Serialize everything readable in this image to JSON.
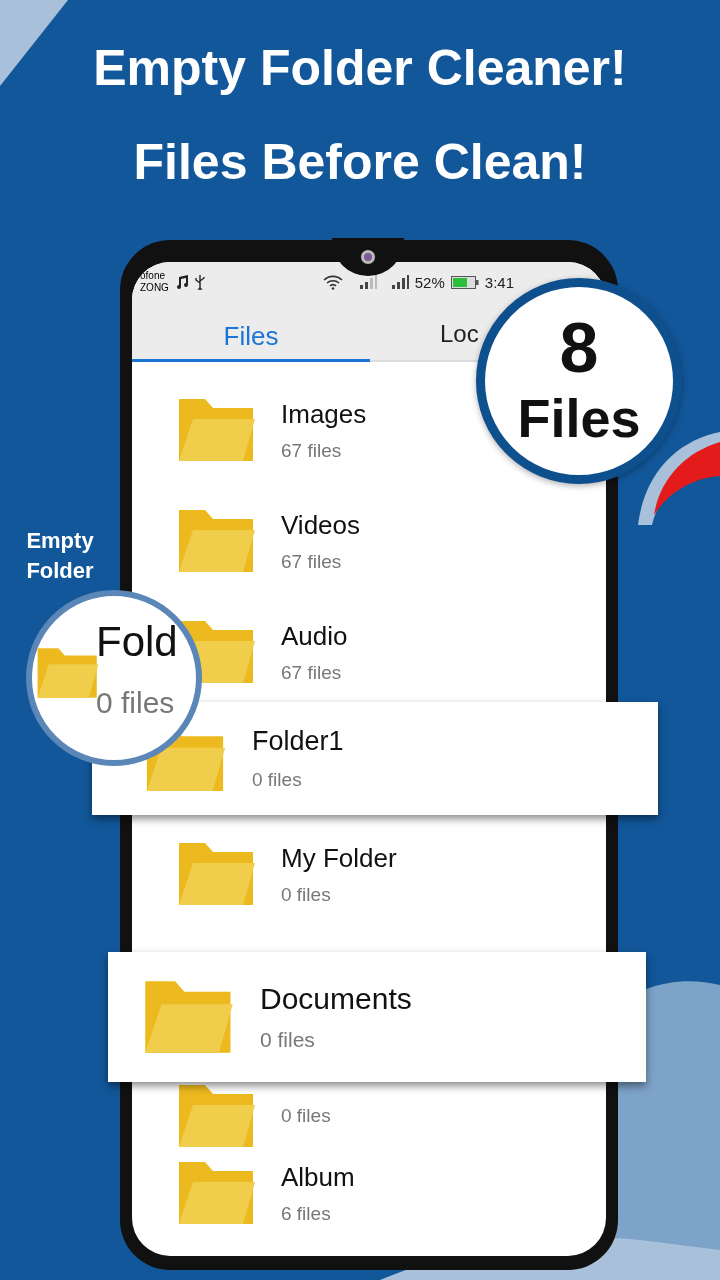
{
  "headline": [
    "Empty Folder Cleaner!",
    "Files Before Clean!"
  ],
  "side_label": "Empty Folder",
  "phone": {
    "status_bar": {
      "carrier": [
        "ofone",
        "ZONG"
      ],
      "battery": "52%",
      "time": "3:41"
    },
    "tabs": [
      {
        "label": "Files",
        "selected": true
      },
      {
        "label": "Loc",
        "selected": false
      }
    ],
    "folders": [
      {
        "name": "Images",
        "meta": "67 files"
      },
      {
        "name": "Videos",
        "meta": "67 files"
      },
      {
        "name": "Audio",
        "meta": "67 files"
      },
      {
        "name": "My Folder",
        "meta": "0 files"
      },
      {
        "meta": "0 files"
      },
      {
        "name": "Album",
        "meta": "6 files"
      }
    ]
  },
  "count_badge": {
    "number": "8",
    "label": "Files"
  },
  "magnifier": {
    "name": "Fold",
    "meta": "0 files"
  },
  "highlighted": [
    {
      "name": "Folder1",
      "meta": "0 files"
    },
    {
      "name": "Documents",
      "meta": "0 files"
    }
  ]
}
